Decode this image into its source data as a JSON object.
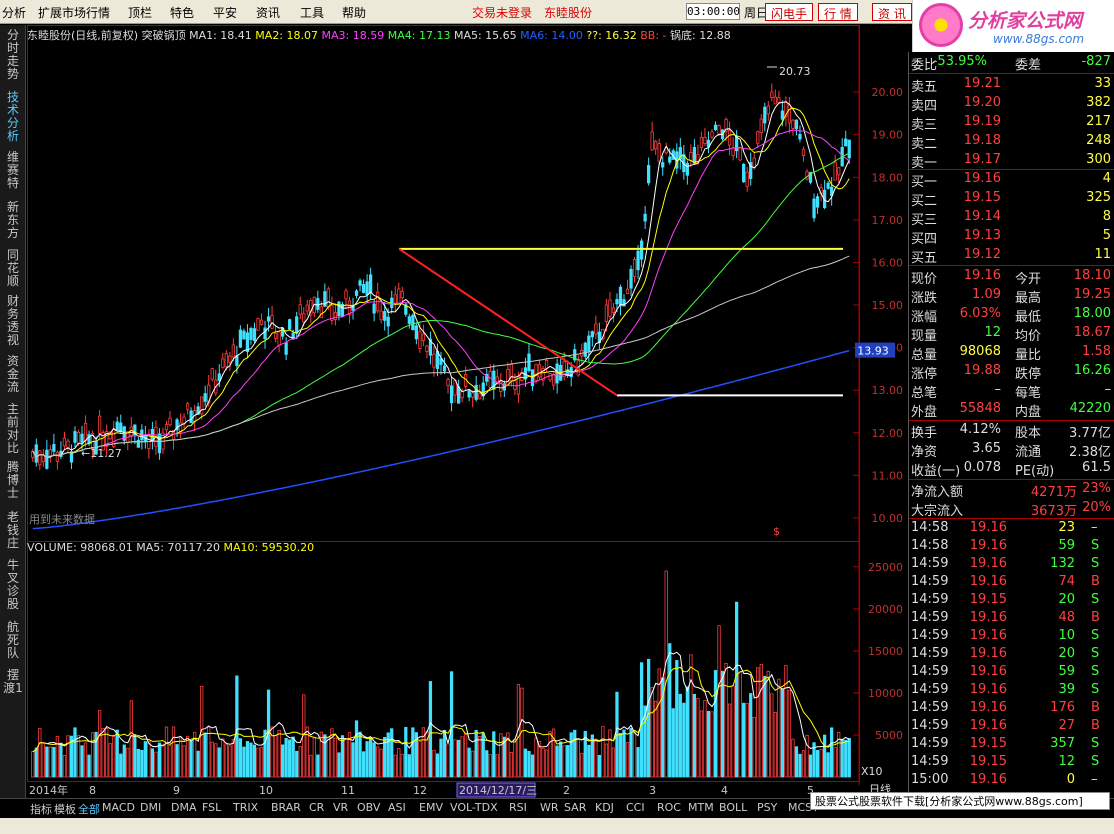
{
  "menu": {
    "items": [
      "分析",
      "扩展市场行情",
      "顶栏",
      "特色",
      "平安",
      "资讯",
      "工具",
      "帮助"
    ],
    "login": "交易未登录",
    "stock": "东睦股份",
    "time": "03:00:00",
    "weekday": "周日",
    "buttons": [
      "闪电手",
      "行 情",
      "资 讯"
    ]
  },
  "logo": {
    "text": "分析家公式网",
    "url": "www.88gs.com"
  },
  "left_tabs": [
    "分时走势",
    "技术分析",
    "维赛特",
    "新东方",
    "同花顺",
    "财务透视",
    "资金流",
    "主前对比",
    "腾博士",
    "老钱庄",
    "牛叉诊股",
    "航死队",
    "摆渡1"
  ],
  "legend": {
    "title": "东睦股份(日线,前复权) 突破锅顶",
    "ma1": "MA1: 18.41",
    "ma2": "MA2: 18.07",
    "ma3": "MA3: 18.59",
    "ma4": "MA4: 17.13",
    "ma5": "MA5: 15.65",
    "ma6": "MA6: 14.00",
    "qq": "??: 16.32",
    "bb": "BB: -",
    "guodi": "锅底: 12.88"
  },
  "volume_legend": {
    "volume": "VOLUME: 98068.01",
    "ma5": "MA5: 70117.20",
    "ma10": "MA10: 59530.20"
  },
  "colors": {
    "ma1": "#ffffff",
    "ma2": "#ffff00",
    "ma3": "#ff40ff",
    "ma4": "#40ff40",
    "ma5": "#c8c8c8",
    "ma6": "#2050ff",
    "up": "#ff3c3c",
    "down": "#40e0ff",
    "guoding": "#ffff40",
    "guodi_line": "#ffffff",
    "trend": "#ff2020"
  },
  "chart_data": {
    "type": "candlestick",
    "y_ticks": [
      "20.00",
      "19.00",
      "18.00",
      "17.00",
      "16.00",
      "15.00",
      "14.00",
      "13.00",
      "12.00",
      "11.00",
      "10.00"
    ],
    "ylim": [
      9.6,
      21.2
    ],
    "price_tag": "13.93",
    "annotations": {
      "high": "20.73",
      "low": "11.27",
      "note": "用到未来数据"
    },
    "vol_ticks": [
      "25000",
      "20000",
      "15000",
      "10000",
      "5000"
    ],
    "vol_unit": "X10",
    "x_labels": [
      "2014年",
      "8",
      "9",
      "10",
      "11",
      "12",
      "2014/12/17/三",
      "2",
      "3",
      "4",
      "5"
    ],
    "guoding_level": 16.32,
    "guodi_level": 12.88
  },
  "quote": {
    "weibi": {
      "label": "委比",
      "value": "-53.95%",
      "label2": "委差",
      "value2": "-827"
    },
    "asks": [
      {
        "label": "卖五",
        "price": "19.21",
        "vol": "33"
      },
      {
        "label": "卖四",
        "price": "19.20",
        "vol": "382"
      },
      {
        "label": "卖三",
        "price": "19.19",
        "vol": "217"
      },
      {
        "label": "卖二",
        "price": "19.18",
        "vol": "248"
      },
      {
        "label": "卖一",
        "price": "19.17",
        "vol": "300"
      }
    ],
    "bids": [
      {
        "label": "买一",
        "price": "19.16",
        "vol": "4"
      },
      {
        "label": "买二",
        "price": "19.15",
        "vol": "325"
      },
      {
        "label": "买三",
        "price": "19.14",
        "vol": "8"
      },
      {
        "label": "买四",
        "price": "19.13",
        "vol": "5"
      },
      {
        "label": "买五",
        "price": "19.12",
        "vol": "11"
      }
    ],
    "stats": [
      {
        "l1": "现价",
        "v1": "19.16",
        "l2": "今开",
        "v2": "18.10",
        "c1": "#ff4040",
        "c2": "#ff4040"
      },
      {
        "l1": "涨跌",
        "v1": "1.09",
        "l2": "最高",
        "v2": "19.25",
        "c1": "#ff4040",
        "c2": "#ff4040"
      },
      {
        "l1": "涨幅",
        "v1": "6.03%",
        "l2": "最低",
        "v2": "18.00",
        "c1": "#ff4040",
        "c2": "#40ff40"
      },
      {
        "l1": "现量",
        "v1": "12",
        "l2": "均价",
        "v2": "18.67",
        "c1": "#40ff40",
        "c2": "#ff4040"
      },
      {
        "l1": "总量",
        "v1": "98068",
        "l2": "量比",
        "v2": "1.58",
        "c1": "#ffff40",
        "c2": "#ff4040"
      },
      {
        "l1": "涨停",
        "v1": "19.88",
        "l2": "跌停",
        "v2": "16.26",
        "c1": "#ff4040",
        "c2": "#40ff40"
      },
      {
        "l1": "总笔",
        "v1": "–",
        "l2": "每笔",
        "v2": "–",
        "c1": "#ddd",
        "c2": "#ddd"
      },
      {
        "l1": "外盘",
        "v1": "55848",
        "l2": "内盘",
        "v2": "42220",
        "c1": "#ff4040",
        "c2": "#40ff40"
      }
    ],
    "stats2": [
      {
        "l1": "换手",
        "v1": "4.12%",
        "l2": "股本",
        "v2": "3.77亿"
      },
      {
        "l1": "净资",
        "v1": "3.65",
        "l2": "流通",
        "v2": "2.38亿"
      },
      {
        "l1": "收益(一)",
        "v1": "0.078",
        "l2": "PE(动)",
        "v2": "61.5"
      }
    ],
    "flows": [
      {
        "label": "净流入额",
        "value": "4271万",
        "pct": "23%"
      },
      {
        "label": "大宗流入",
        "value": "3673万",
        "pct": "20%"
      }
    ],
    "ticks": [
      {
        "t": "14:58",
        "p": "19.16",
        "v": "23",
        "s": "–"
      },
      {
        "t": "14:58",
        "p": "19.16",
        "v": "59",
        "s": "S"
      },
      {
        "t": "14:59",
        "p": "19.16",
        "v": "132",
        "s": "S"
      },
      {
        "t": "14:59",
        "p": "19.16",
        "v": "74",
        "s": "B"
      },
      {
        "t": "14:59",
        "p": "19.15",
        "v": "20",
        "s": "S"
      },
      {
        "t": "14:59",
        "p": "19.16",
        "v": "48",
        "s": "B"
      },
      {
        "t": "14:59",
        "p": "19.16",
        "v": "10",
        "s": "S"
      },
      {
        "t": "14:59",
        "p": "19.16",
        "v": "20",
        "s": "S"
      },
      {
        "t": "14:59",
        "p": "19.16",
        "v": "59",
        "s": "S"
      },
      {
        "t": "14:59",
        "p": "19.16",
        "v": "39",
        "s": "S"
      },
      {
        "t": "14:59",
        "p": "19.16",
        "v": "176",
        "s": "B"
      },
      {
        "t": "14:59",
        "p": "19.16",
        "v": "27",
        "s": "B"
      },
      {
        "t": "14:59",
        "p": "19.15",
        "v": "357",
        "s": "S"
      },
      {
        "t": "14:59",
        "p": "19.15",
        "v": "12",
        "s": "S"
      },
      {
        "t": "15:00",
        "p": "19.16",
        "v": "0",
        "s": "–"
      }
    ]
  },
  "bottom_tabs": [
    "指标",
    "模板",
    "全部",
    "MACD",
    "DMI",
    "DMA",
    "FSL",
    "TRIX",
    "BRAR",
    "CR",
    "VR",
    "OBV",
    "ASI",
    "EMV",
    "VOL-TDX",
    "RSI",
    "WR",
    "SAR",
    "KDJ",
    "CCI",
    "ROC",
    "MTM",
    "BOLL",
    "PSY",
    "MCST"
  ],
  "footer_ad": "股票公式股票软件下载[分析家公式网www.88gs.com]",
  "period_label": "日线"
}
